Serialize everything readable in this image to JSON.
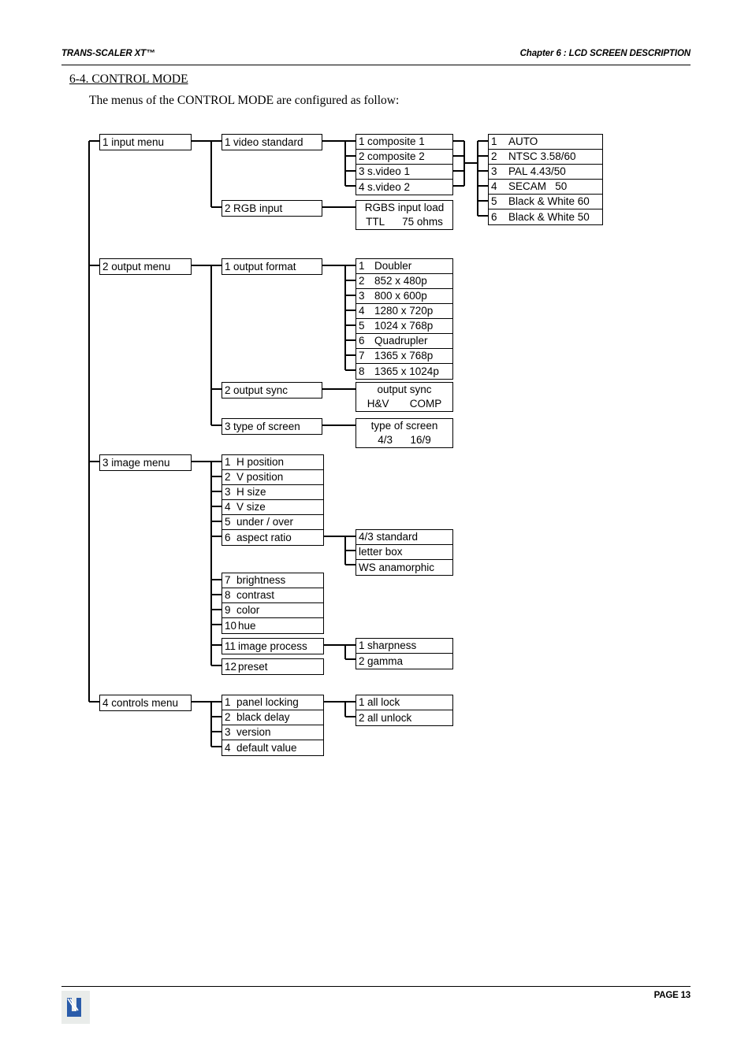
{
  "header": {
    "left": "TRANS-SCALER XT™",
    "right": "Chapter 6 : LCD SCREEN DESCRIPTION"
  },
  "section": {
    "heading": "6-4. CONTROL MODE",
    "intro": "The menus of the CONTROL MODE are configured as follow:"
  },
  "footer": {
    "page_label": "PAGE 13",
    "logo_name": "company-logo"
  },
  "colors": {
    "ink": "#000000",
    "page": "#ffffff",
    "logo_blue": "#2a5caa",
    "logo_plate": "#e9ecea"
  },
  "diagram": {
    "type": "menu-tree",
    "root_menus": [
      {
        "id": "input",
        "num": "1",
        "label": "input menu"
      },
      {
        "id": "output",
        "num": "2",
        "label": "output menu"
      },
      {
        "id": "image",
        "num": "3",
        "label": "image menu"
      },
      {
        "id": "controls",
        "num": "4",
        "label": "controls menu"
      }
    ],
    "input_menu": {
      "label": "1 input menu",
      "children": [
        {
          "num": "1",
          "label": "video standard"
        },
        {
          "num": "2",
          "label": "RGB input"
        }
      ],
      "video_sources": [
        {
          "num": "1",
          "label": "composite 1"
        },
        {
          "num": "2",
          "label": "composite 2"
        },
        {
          "num": "3",
          "label": "s.video 1"
        },
        {
          "num": "4",
          "label": "s.video 2"
        }
      ],
      "video_standards": [
        {
          "num": "1",
          "label": "AUTO"
        },
        {
          "num": "2",
          "label": "NTSC 3.58/60"
        },
        {
          "num": "3",
          "label": "PAL 4.43/50"
        },
        {
          "num": "4",
          "label": "SECAM   50"
        },
        {
          "num": "5",
          "label": "Black & White 60"
        },
        {
          "num": "6",
          "label": "Black & White 50"
        }
      ],
      "rgb_input_load": {
        "line1": "RGBS input load",
        "line2": "TTL      75 ohms"
      }
    },
    "output_menu": {
      "label": "2 output menu",
      "children": [
        {
          "num": "1",
          "label": "output format"
        },
        {
          "num": "2",
          "label": "output sync"
        },
        {
          "num": "3",
          "label": "type of screen"
        }
      ],
      "output_formats": [
        {
          "num": "1",
          "label": "Doubler"
        },
        {
          "num": "2",
          "label": "852 x 480p"
        },
        {
          "num": "3",
          "label": "800 x 600p"
        },
        {
          "num": "4",
          "label": "1280 x 720p"
        },
        {
          "num": "5",
          "label": "1024 x 768p"
        },
        {
          "num": "6",
          "label": "Quadrupler"
        },
        {
          "num": "7",
          "label": "1365 x 768p"
        },
        {
          "num": "8",
          "label": "1365 x 1024p"
        }
      ],
      "output_sync": {
        "line1": "output sync",
        "line2": "H&V       COMP"
      },
      "type_of_screen": {
        "line1": "type of screen",
        "line2": "4/3      16/9"
      }
    },
    "image_menu": {
      "label": "3 image menu",
      "group_a": [
        {
          "num": "1",
          "label": "H position"
        },
        {
          "num": "2",
          "label": "V position"
        },
        {
          "num": "3",
          "label": "H size"
        },
        {
          "num": "4",
          "label": "V size"
        },
        {
          "num": "5",
          "label": "under / over"
        },
        {
          "num": "6",
          "label": "aspect ratio"
        }
      ],
      "group_b": [
        {
          "num": "7",
          "label": "brightness"
        },
        {
          "num": "8",
          "label": "contrast"
        },
        {
          "num": "9",
          "label": "color"
        },
        {
          "num": "10",
          "label": "hue"
        }
      ],
      "group_c": [
        {
          "num": "11",
          "label": "image process"
        }
      ],
      "group_d": [
        {
          "num": "12",
          "label": "preset"
        }
      ],
      "aspect_ratios": [
        {
          "num": "",
          "label": "4/3 standard"
        },
        {
          "num": "",
          "label": "letter box"
        },
        {
          "num": "",
          "label": "WS anamorphic"
        }
      ],
      "image_process_items": [
        {
          "num": "1",
          "label": "sharpness"
        },
        {
          "num": "2",
          "label": "gamma"
        }
      ]
    },
    "controls_menu": {
      "label": "4 controls menu",
      "children": [
        {
          "num": "1",
          "label": "panel locking"
        },
        {
          "num": "2",
          "label": "black delay"
        },
        {
          "num": "3",
          "label": "version"
        },
        {
          "num": "4",
          "label": "default value"
        }
      ],
      "panel_locking_items": [
        {
          "num": "1",
          "label": "all lock"
        },
        {
          "num": "2",
          "label": "all unlock"
        }
      ]
    }
  }
}
